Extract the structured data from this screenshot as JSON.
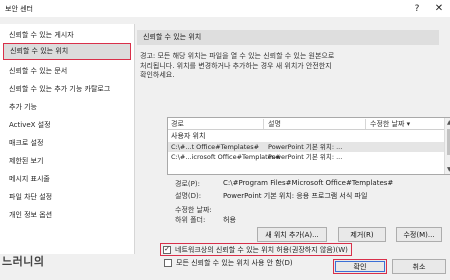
{
  "window": {
    "title": "보안 센터",
    "help_glyph": "?",
    "close_glyph": "✕"
  },
  "sidebar": {
    "items": [
      {
        "label": "신뢰할 수 있는 게시자"
      },
      {
        "label": "신뢰할 수 있는 위치",
        "selected": true
      },
      {
        "label": "신뢰할 수 있는 문서"
      },
      {
        "label": "신뢰할 수 있는 추가 기능 카탈로그"
      },
      {
        "label": "추가 기능"
      },
      {
        "label": "ActiveX 설정"
      },
      {
        "label": "매크로 설정"
      },
      {
        "label": "제한된 보기"
      },
      {
        "label": "메시지 표시줄"
      },
      {
        "label": "파일 차단 설정"
      },
      {
        "label": "개인 정보 옵션"
      }
    ]
  },
  "main": {
    "section_title": "신뢰할 수 있는 위치",
    "description": [
      "경고: 모든 해당 위치는 파일을 열 수 있는 신뢰할 수 있는 원본으로",
      "처리됩니다. 위치를 변경하거나 추가하는 경우 새 위치가 안전한지",
      "확인하세요."
    ],
    "table": {
      "columns": [
        "경로",
        "설명",
        "수정한 날짜"
      ],
      "sort_glyph": "▾",
      "group_label": "사용자 위치",
      "rows": [
        {
          "path": "C:\\#...t Office#Templates#",
          "description": "PowerPoint 기본 위치: ..."
        },
        {
          "path": "C:\\#...icrosoft Office#Templates#",
          "description": "PowerPoint 기본 위치: ..."
        }
      ]
    },
    "details": {
      "path_label": "경로(P):",
      "path_value": "C:\\#Program Files#Microsoft Office#Templates#",
      "desc_label": "설명(D):",
      "desc_value": "PowerPoint 기본 위치: 응용 프로그램 서식 파일",
      "modified_label": "수정한 날짜:",
      "subfolders_label": "하위 폴더:",
      "subfolders_value": "허용"
    },
    "buttons": {
      "add": "새 위치 추가(A)...",
      "remove": "제거(R)",
      "modify": "수정(M)..."
    },
    "checkboxes": [
      {
        "label": "네트워크상의 신뢰할 수 있는 위치 허용(권장하지 않음)(W)",
        "checked": true,
        "mark": "✓"
      },
      {
        "label": "모든 신뢰할 수 있는 위치 사용 안 함(D)",
        "checked": false,
        "mark": ""
      }
    ]
  },
  "footer": {
    "ok": "확인",
    "cancel": "취소"
  },
  "watermark": "느러니의",
  "accent_colors": {
    "highlight": "#d9304a",
    "focus": "#3b6fd6"
  }
}
